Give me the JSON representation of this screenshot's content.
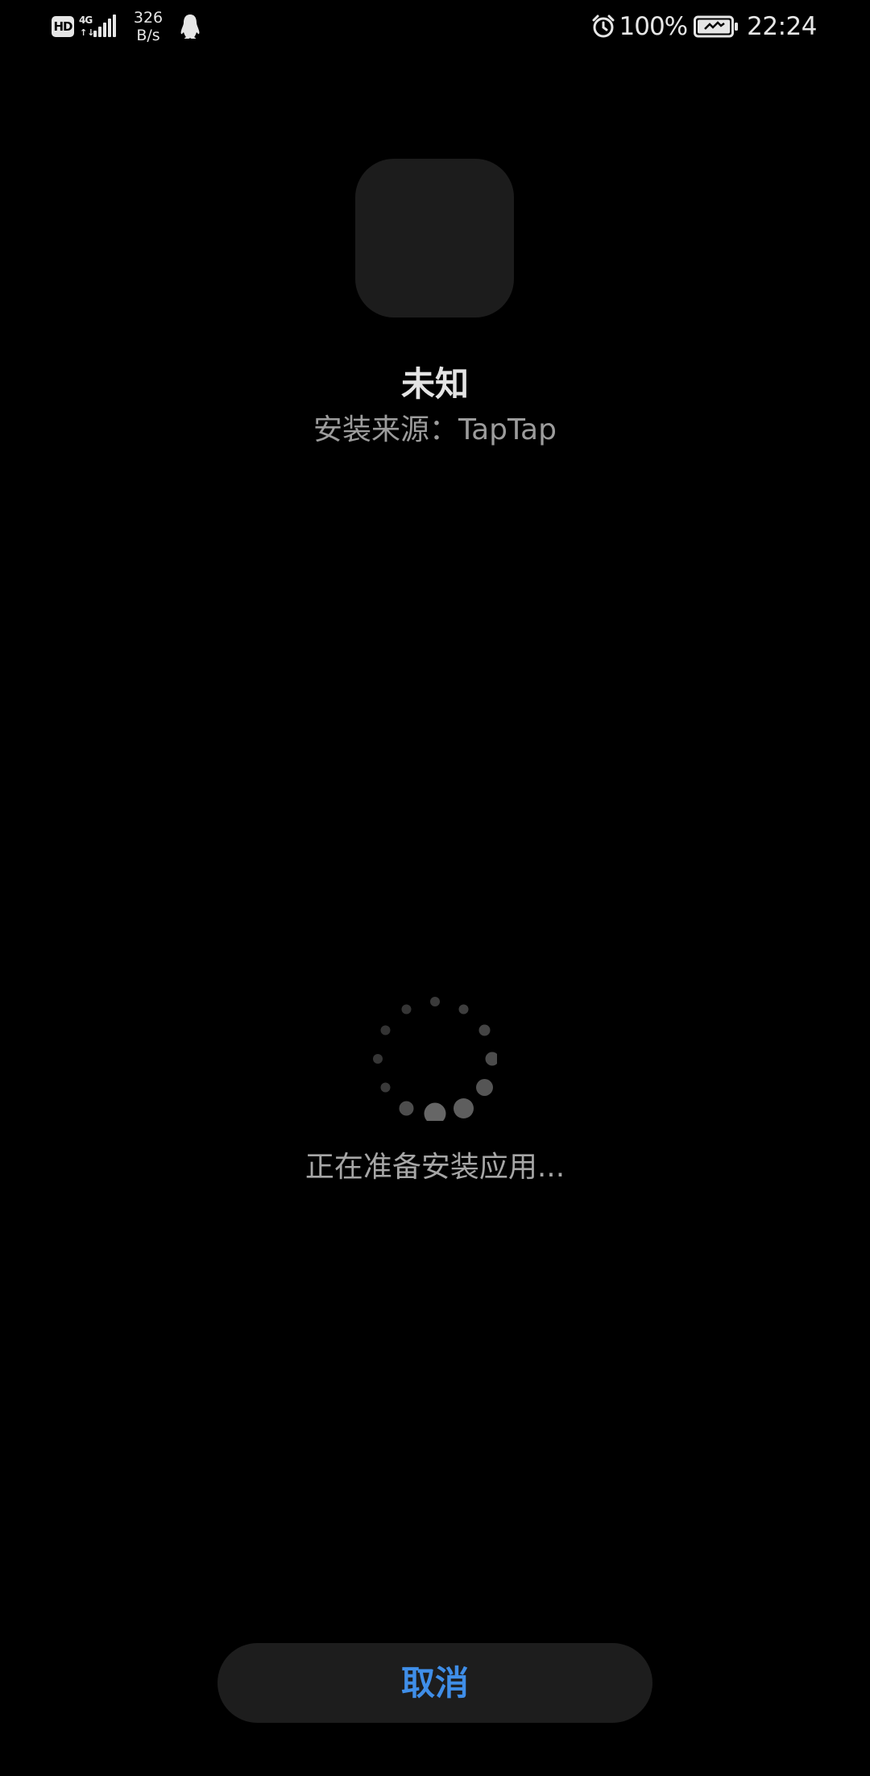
{
  "status_bar": {
    "hd_label": "HD",
    "network_type": "4G",
    "network_arrows": "↑↓",
    "speed_value": "326",
    "speed_unit": "B/s",
    "notification_icon": "qq-penguin-icon",
    "alarm_icon": "alarm-clock-icon",
    "battery_percent": "100%",
    "battery_icon": "battery-charging-icon",
    "time": "22:24"
  },
  "app": {
    "name": "未知",
    "install_source": "安装来源：TapTap"
  },
  "loading": {
    "icon": "loading-spinner-icon",
    "text": "正在准备安装应用..."
  },
  "actions": {
    "cancel_label": "取消"
  },
  "colors": {
    "background": "#000000",
    "icon_placeholder": "#1c1c1c",
    "button_background": "#1d1d1d",
    "accent": "#3f8ee8",
    "secondary_text": "#9c9c9c"
  }
}
